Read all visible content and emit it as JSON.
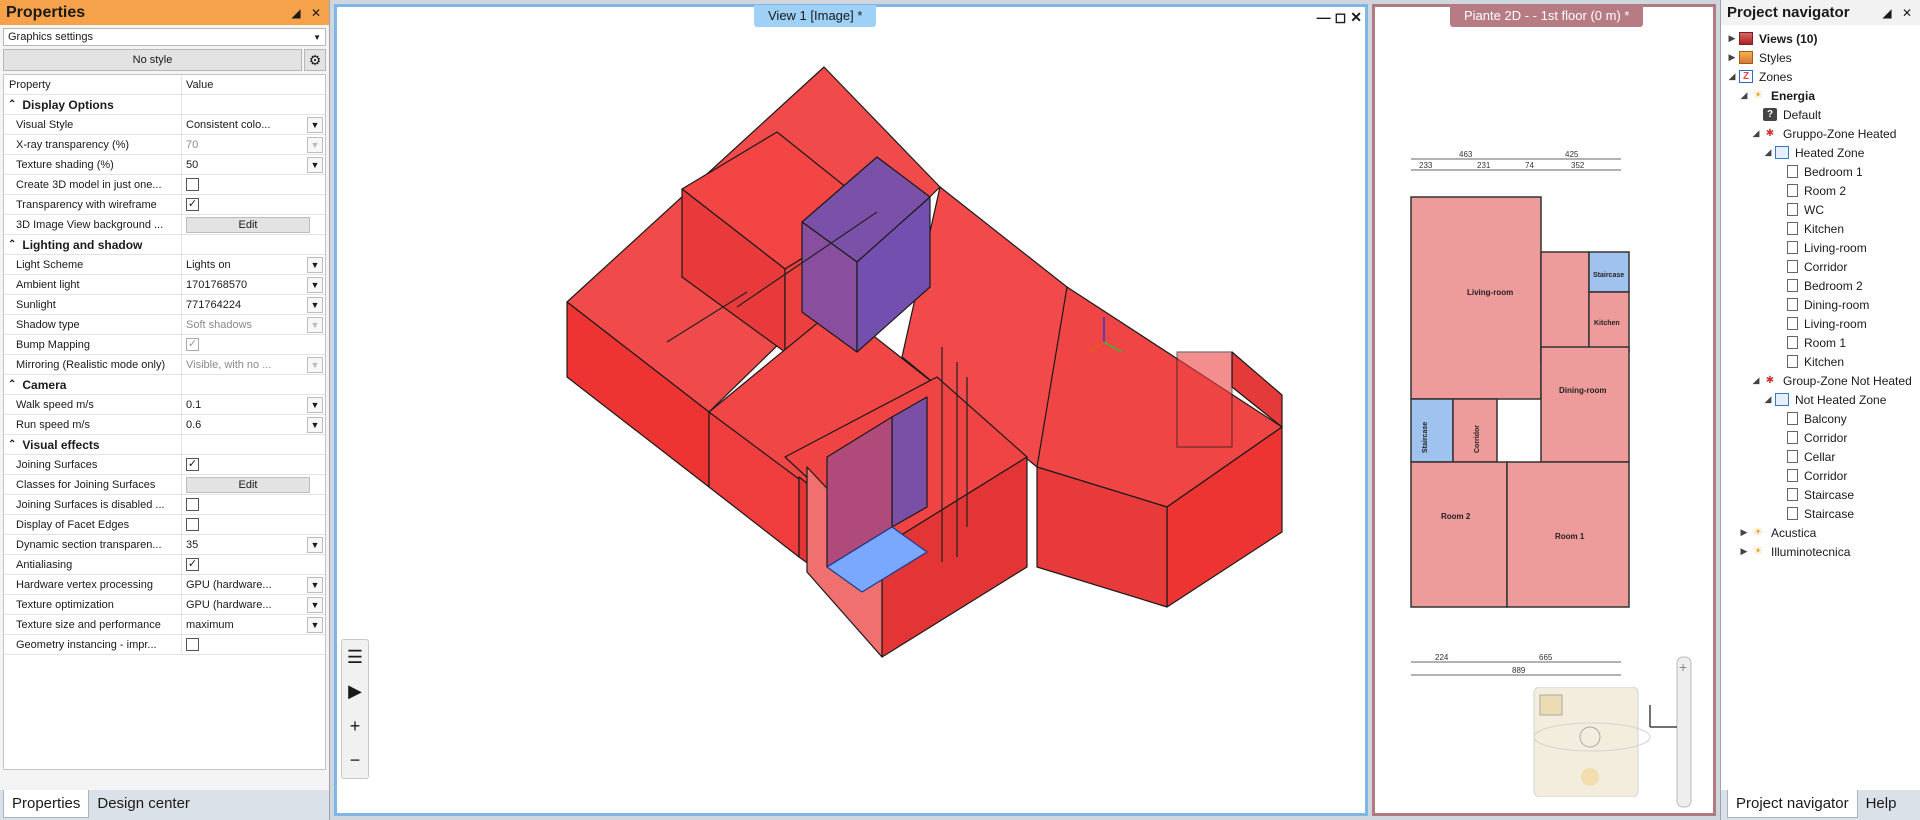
{
  "properties": {
    "title": "Properties",
    "pin_icon": "pin-icon",
    "close_icon": "close-icon",
    "category": "Graphics settings",
    "style_button": "No style",
    "grid_header": {
      "property": "Property",
      "value": "Value"
    },
    "sections": {
      "display": "Display Options",
      "lighting": "Lighting and shadow",
      "camera": "Camera",
      "effects": "Visual effects"
    },
    "rows": {
      "visual_style": {
        "label": "Visual Style",
        "value": "Consistent colo..."
      },
      "xray": {
        "label": "X-ray transparency (%)",
        "value": "70"
      },
      "texture_shading": {
        "label": "Texture shading (%)",
        "value": "50"
      },
      "create_3d": {
        "label": "Create 3D model in just one..."
      },
      "transparency_wire": {
        "label": "Transparency with wireframe"
      },
      "bg_3d": {
        "label": "3D Image View background ...",
        "button": "Edit"
      },
      "light_scheme": {
        "label": "Light Scheme",
        "value": "Lights on"
      },
      "ambient": {
        "label": "Ambient light",
        "value": "1701768570"
      },
      "sunlight": {
        "label": "Sunlight",
        "value": "771764224"
      },
      "shadow": {
        "label": "Shadow type",
        "value": "Soft shadows"
      },
      "bump": {
        "label": "Bump Mapping"
      },
      "mirroring": {
        "label": "Mirroring (Realistic mode only)",
        "value": "Visible, with no ..."
      },
      "walk": {
        "label": "Walk speed m/s",
        "value": "0.1"
      },
      "run": {
        "label": "Run speed m/s",
        "value": "0.6"
      },
      "joining": {
        "label": "Joining Surfaces"
      },
      "classes_joining": {
        "label": "Classes for Joining Surfaces",
        "button": "Edit"
      },
      "joining_disabled": {
        "label": "Joining Surfaces is disabled ..."
      },
      "facet_edges": {
        "label": "Display of Facet Edges"
      },
      "dyn_section": {
        "label": "Dynamic section transparen...",
        "value": "35"
      },
      "antialias": {
        "label": "Antialiasing"
      },
      "hw_vertex": {
        "label": "Hardware vertex processing",
        "value": "GPU (hardware..."
      },
      "tex_opt": {
        "label": "Texture optimization",
        "value": "GPU (hardware..."
      },
      "tex_size": {
        "label": "Texture size and performance",
        "value": "maximum"
      },
      "geo_inst": {
        "label": "Geometry instancing - impr..."
      }
    },
    "tabs": [
      "Properties",
      "Design center"
    ]
  },
  "view3d": {
    "tab": "View 1 [Image] *"
  },
  "view2d": {
    "tab": "Piante 2D -  - 1st floor (0 m) *",
    "rooms": {
      "living": "Living-room",
      "staircase_top": "Staircase",
      "kitchen": "Kitchen",
      "dining": "Dining-room",
      "staircase_left": "Staircase",
      "corridor": "Corridor",
      "room2": "Room 2",
      "room1": "Room 1"
    },
    "dims": {
      "d463": "463",
      "d425": "425",
      "d233": "233",
      "d231": "231",
      "d74": "74",
      "d352": "352",
      "d224": "224",
      "d665": "665",
      "d889": "889"
    }
  },
  "navigator": {
    "title": "Project navigator",
    "tree": {
      "views": "Views (10)",
      "styles": "Styles",
      "zones": "Zones",
      "energia": "Energia",
      "default": "Default",
      "heated_group": "Gruppo-Zone Heated",
      "heated_zone": "Heated Zone",
      "heated_rooms": [
        "Bedroom 1",
        "Room 2",
        "WC",
        "Kitchen",
        "Living-room",
        "Corridor",
        "Bedroom 2",
        "Dining-room",
        "Living-room",
        "Room 1",
        "Kitchen"
      ],
      "notheated_group": "Group-Zone Not Heated",
      "notheated_zone": "Not Heated Zone",
      "notheated_rooms": [
        "Balcony",
        "Corridor",
        "Cellar",
        "Corridor",
        "Staircase",
        "Staircase"
      ],
      "acustica": "Acustica",
      "illuminotecnica": "Illuminotecnica"
    },
    "tabs": [
      "Project navigator",
      "Help"
    ]
  }
}
